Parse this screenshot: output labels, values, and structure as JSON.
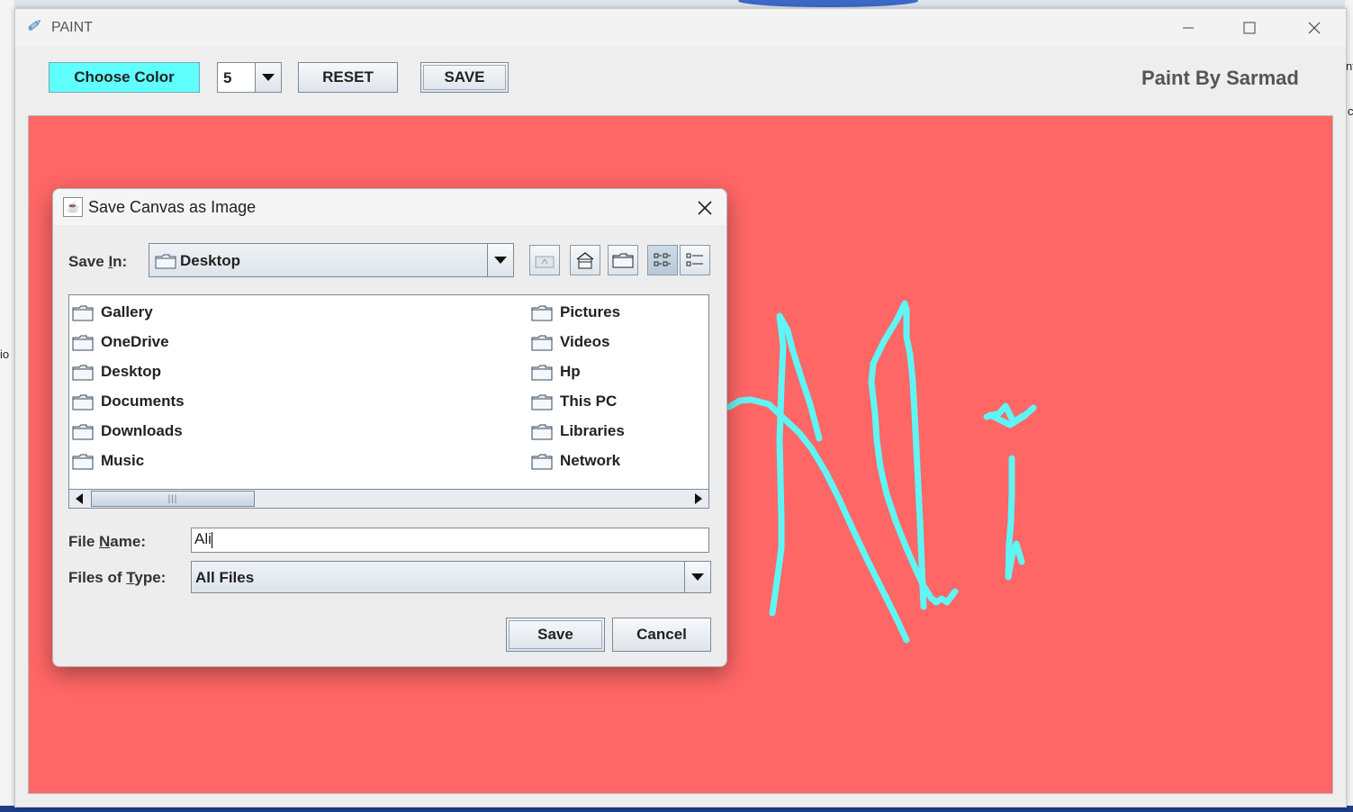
{
  "window": {
    "title": "PAINT",
    "controls": {
      "minimize": "–",
      "maximize": "☐",
      "close": "✕"
    }
  },
  "toolbar": {
    "choose_color_label": "Choose Color",
    "brush_size_value": "5",
    "reset_label": "RESET",
    "save_label": "SAVE",
    "brand_text": "Paint By Sarmad",
    "choose_color_bg": "#5ffffe"
  },
  "canvas": {
    "background": "#ff6666",
    "stroke_color": "#5ff5f5"
  },
  "dialog": {
    "title": "Save Canvas as Image",
    "save_in_label_pre": "Save ",
    "save_in_label_mnemonic": "I",
    "save_in_label_post": "n:",
    "save_in_value": "Desktop",
    "folders": [
      "Gallery",
      "OneDrive",
      "Desktop",
      "Documents",
      "Downloads",
      "Music",
      "Pictures",
      "Videos",
      "Hp",
      "This PC",
      "Libraries",
      "Network"
    ],
    "file_name_label_pre": "File ",
    "file_name_label_mnemonic": "N",
    "file_name_label_post": "ame:",
    "file_name_value": "Ali",
    "files_of_type_label_pre": "Files of ",
    "files_of_type_label_mnemonic": "T",
    "files_of_type_label_post": "ype:",
    "files_of_type_value": "All Files",
    "save_button": "Save",
    "cancel_button": "Cancel"
  },
  "background_fragments": [
    "nt",
    "c",
    "io"
  ]
}
